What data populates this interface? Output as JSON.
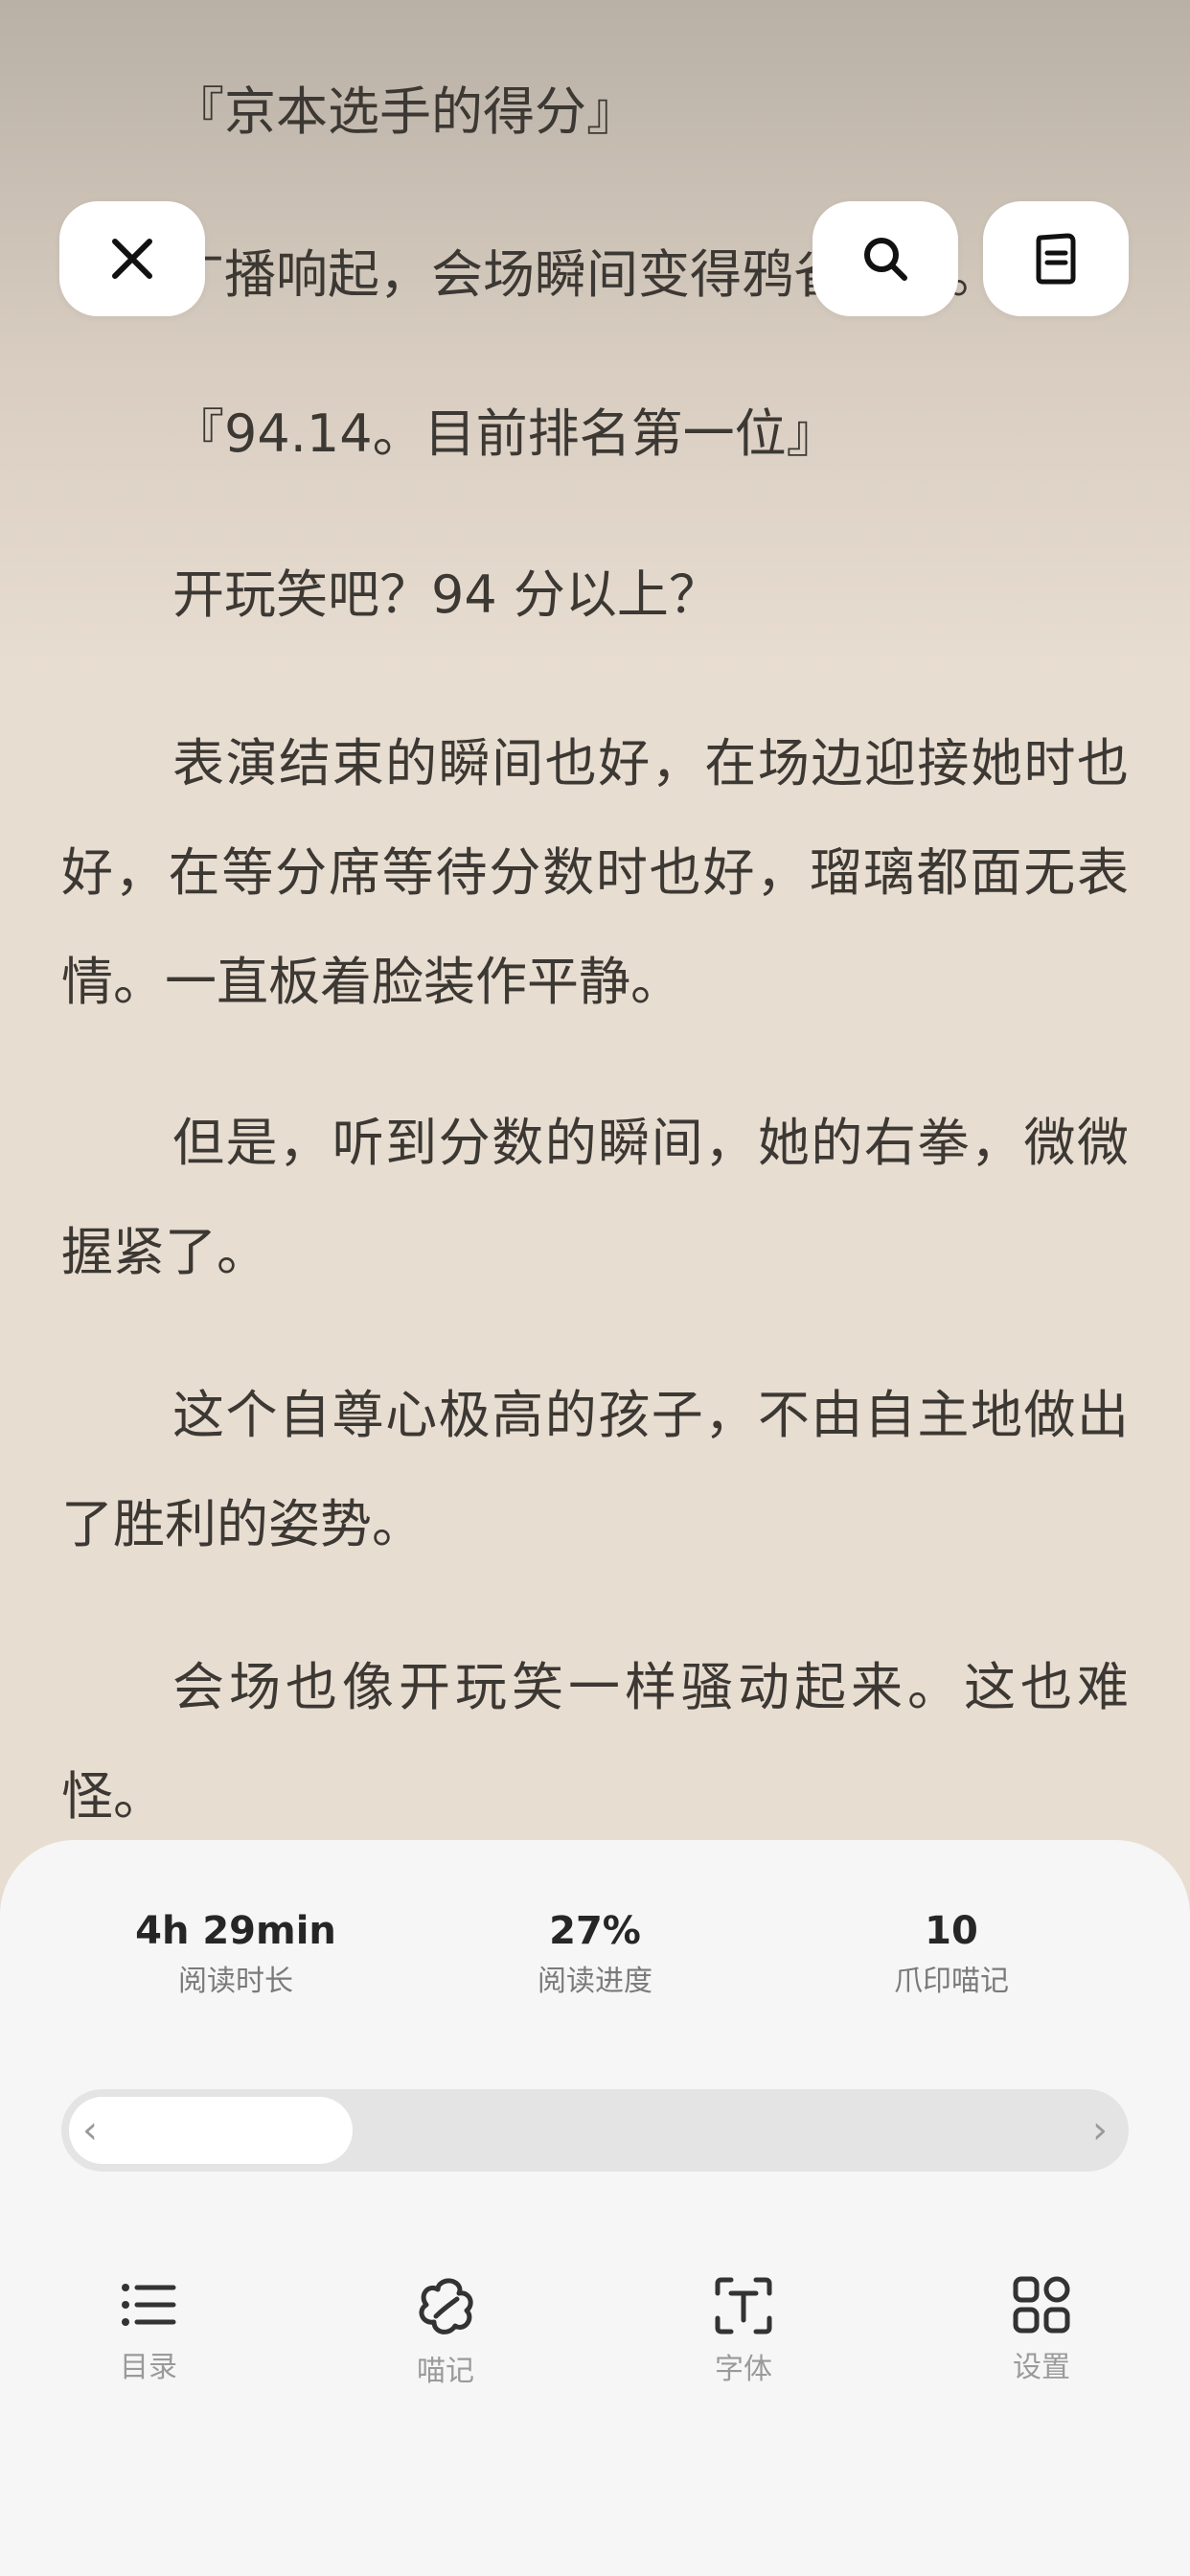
{
  "reader": {
    "paragraphs": [
      "『京本选手的得分』",
      "广播响起，会场瞬间变得鸦雀无声。",
      "『94.14。目前排名第一位』",
      "开玩笑吧？94 分以上？",
      "表演结束的瞬间也好，在场边迎接她时也好，在等分席等待分数时也好，瑠璃都面无表情。一直板着脸装作平静。",
      "但是，听到分数的瞬间，她的右拳，微微握紧了。",
      "这个自尊心极高的孩子，不由自主地做出了胜利的姿势。",
      "会场也像开玩笑一样骚动起来。这也难怪。"
    ]
  },
  "top_buttons": {
    "close_icon": "close-icon",
    "search_icon": "search-icon",
    "notes_icon": "note-icon"
  },
  "stats": [
    {
      "value": "4h 29min",
      "label": "阅读时长"
    },
    {
      "value": "27%",
      "label": "阅读进度"
    },
    {
      "value": "10",
      "label": "爪印喵记"
    }
  ],
  "progress": {
    "fraction": 0.27,
    "prev_icon": "‹",
    "next_icon": "›"
  },
  "nav": [
    {
      "label": "目录",
      "icon": "list-icon"
    },
    {
      "label": "喵记",
      "icon": "paw-icon"
    },
    {
      "label": "字体",
      "icon": "font-icon"
    },
    {
      "label": "设置",
      "icon": "grid-icon"
    }
  ],
  "colors": {
    "panel": "#f6f6f6",
    "text": "#3c3833",
    "accent": "#262626"
  }
}
